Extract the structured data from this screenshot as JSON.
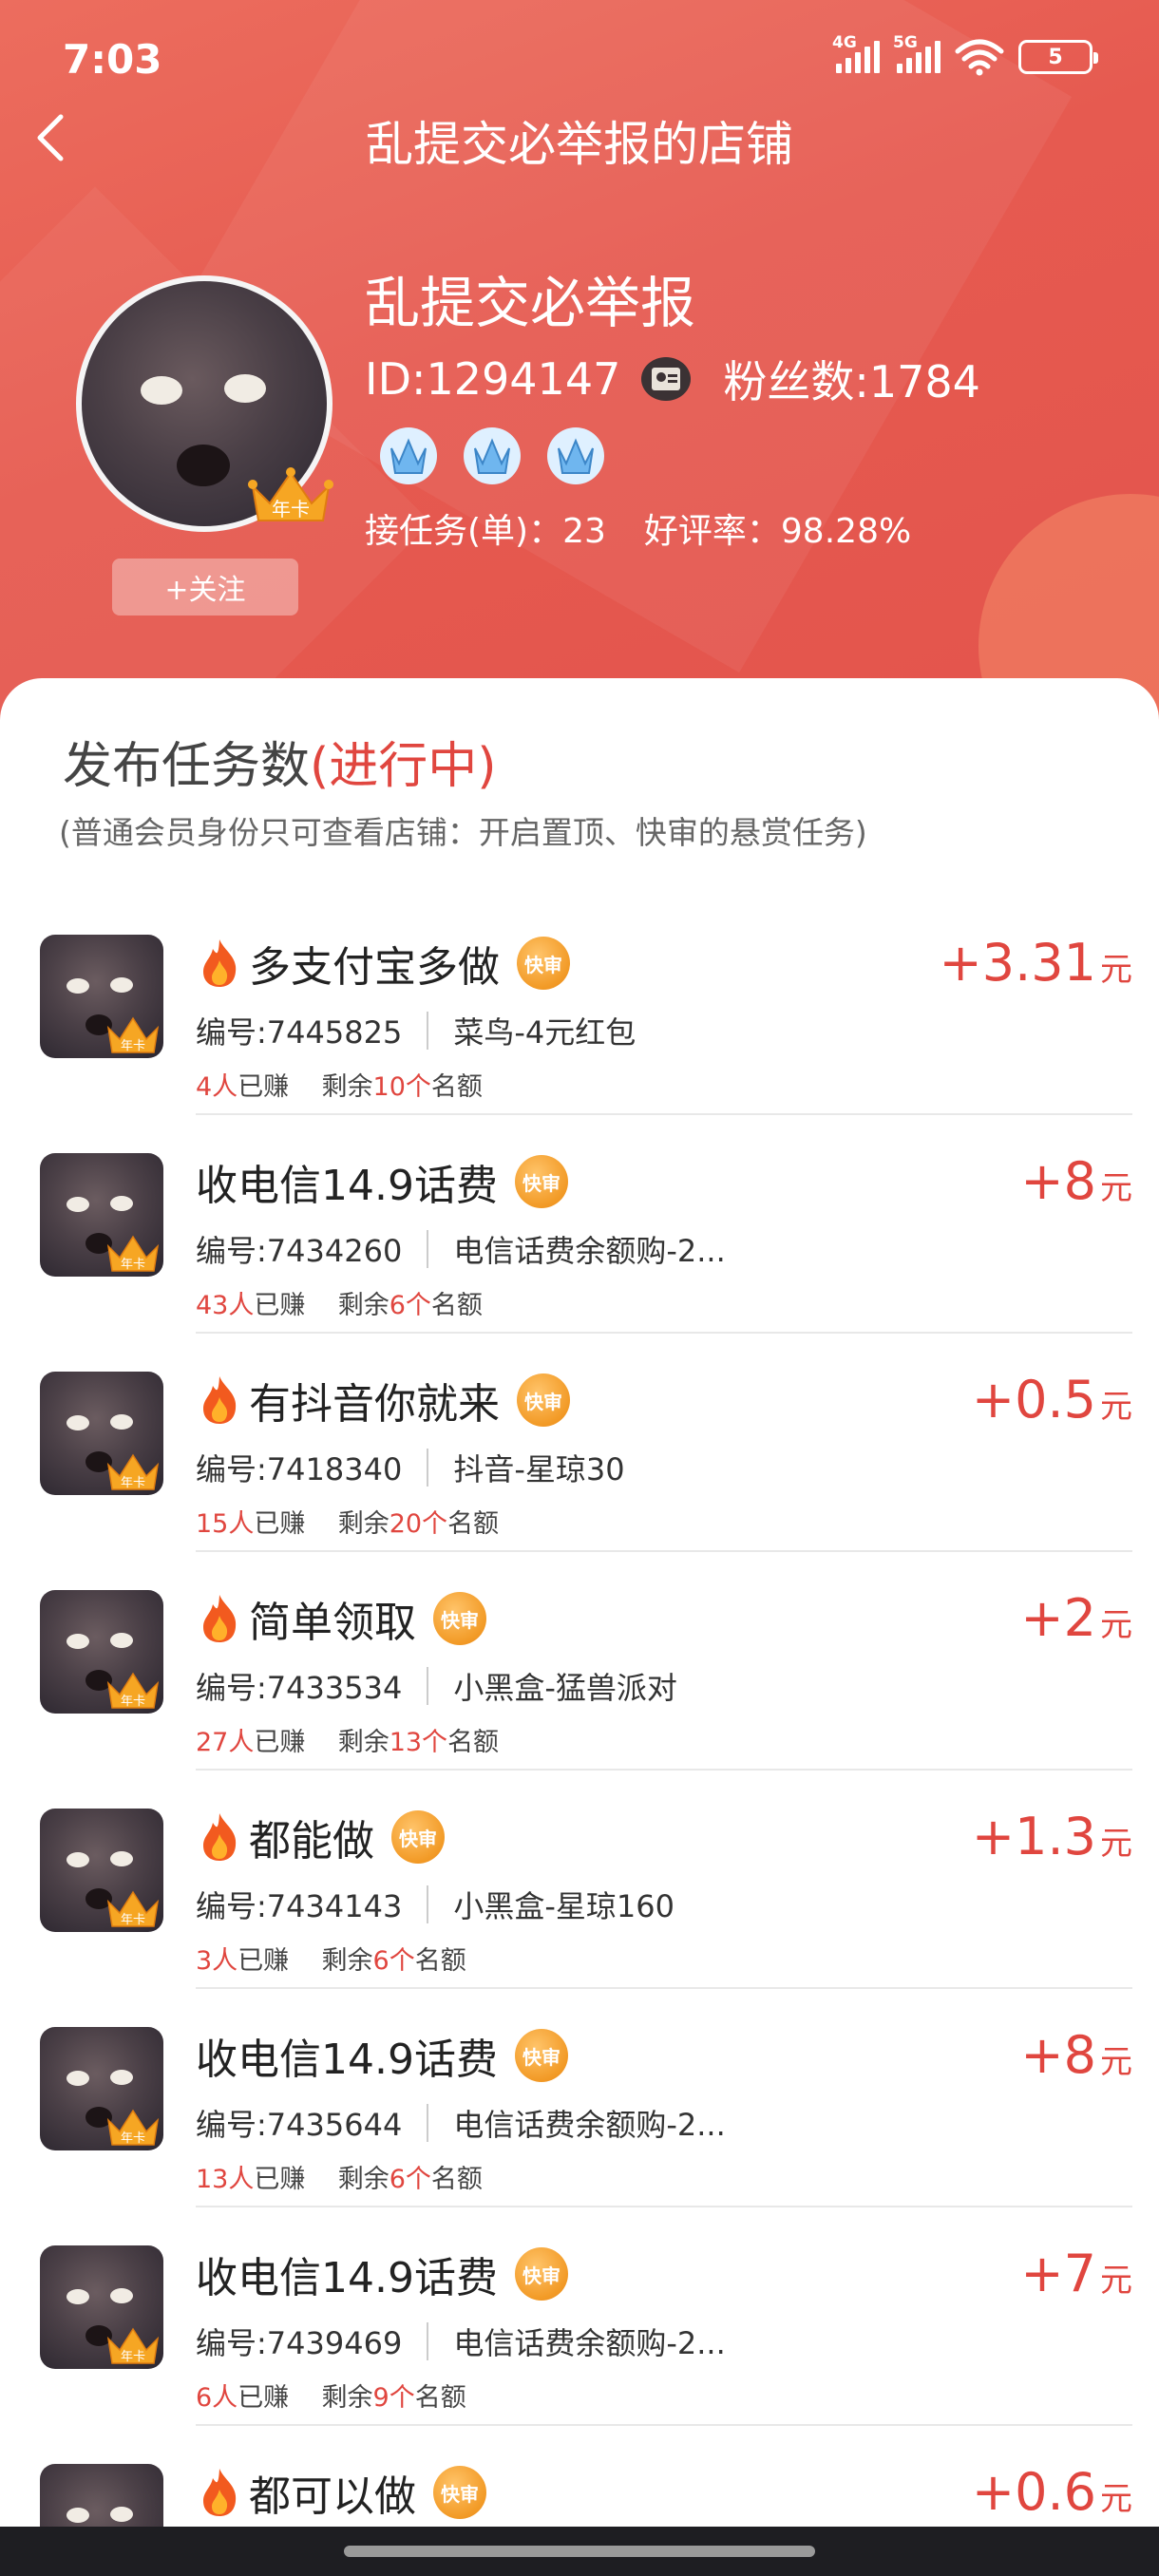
{
  "status_bar": {
    "time": "7:03",
    "net1": "4G",
    "net2": "5G",
    "battery": "5"
  },
  "page": {
    "title": "乱提交必举报的店铺"
  },
  "shop": {
    "name": "乱提交必举报",
    "id_text": "ID:1294147",
    "fans_text": "粉丝数:1784",
    "crown_label": "年卡",
    "follow_label": "+关注",
    "tasks_label": "接任务(单)：23",
    "rating_label": "好评率：98.28%"
  },
  "section": {
    "title": "发布任务数",
    "status": "(进行中)",
    "note": "(普通会员身份只可查看店铺：开启置顶、快审的悬赏任务)"
  },
  "badge_label": "快审",
  "reward_unit": "元",
  "tasks": [
    {
      "fire": true,
      "title": "多支付宝多做",
      "number": "编号:7445825",
      "desc": "菜鸟-4元红包",
      "earned": "4人",
      "earned_suffix": "已赚",
      "remain_prefix": "剩余",
      "remain": "10个",
      "remain_suffix": "名额",
      "reward": "+3.31"
    },
    {
      "fire": false,
      "title": "收电信14.9话费",
      "number": "编号:7434260",
      "desc": "电信话费余额购-2...",
      "earned": "43人",
      "earned_suffix": "已赚",
      "remain_prefix": "剩余",
      "remain": "6个",
      "remain_suffix": "名额",
      "reward": "+8"
    },
    {
      "fire": true,
      "title": "有抖音你就来",
      "number": "编号:7418340",
      "desc": "抖音-星琼30",
      "earned": "15人",
      "earned_suffix": "已赚",
      "remain_prefix": "剩余",
      "remain": "20个",
      "remain_suffix": "名额",
      "reward": "+0.5"
    },
    {
      "fire": true,
      "title": "简单领取",
      "number": "编号:7433534",
      "desc": "小黑盒-猛兽派对",
      "earned": "27人",
      "earned_suffix": "已赚",
      "remain_prefix": "剩余",
      "remain": "13个",
      "remain_suffix": "名额",
      "reward": "+2"
    },
    {
      "fire": true,
      "title": "都能做",
      "number": "编号:7434143",
      "desc": "小黑盒-星琼160",
      "earned": "3人",
      "earned_suffix": "已赚",
      "remain_prefix": "剩余",
      "remain": "6个",
      "remain_suffix": "名额",
      "reward": "+1.3"
    },
    {
      "fire": false,
      "title": "收电信14.9话费",
      "number": "编号:7435644",
      "desc": "电信话费余额购-2...",
      "earned": "13人",
      "earned_suffix": "已赚",
      "remain_prefix": "剩余",
      "remain": "6个",
      "remain_suffix": "名额",
      "reward": "+8"
    },
    {
      "fire": false,
      "title": "收电信14.9话费",
      "number": "编号:7439469",
      "desc": "电信话费余额购-2...",
      "earned": "6人",
      "earned_suffix": "已赚",
      "remain_prefix": "剩余",
      "remain": "9个",
      "remain_suffix": "名额",
      "reward": "+7"
    },
    {
      "fire": true,
      "title": "都可以做",
      "number": "",
      "desc": "",
      "earned": "",
      "earned_suffix": "",
      "remain_prefix": "",
      "remain": "",
      "remain_suffix": "",
      "reward": "+0.6"
    }
  ]
}
